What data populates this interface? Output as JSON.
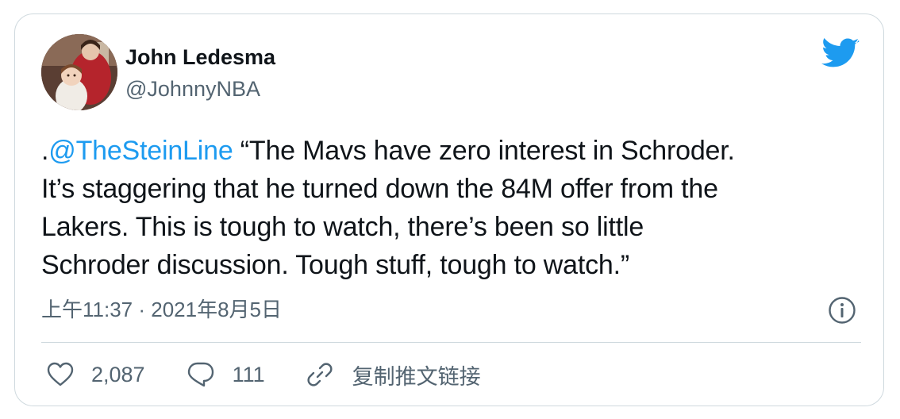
{
  "author": {
    "name": "John Ledesma",
    "handle": "@JohnnyNBA"
  },
  "tweet": {
    "prefix": ".",
    "mention": "@TheSteinLine",
    "line1_rest": " “The Mavs have zero interest in Schroder.",
    "line2": "It’s staggering that he turned down the 84M offer from the",
    "line3": "Lakers. This is tough to watch, there’s been so little",
    "line4": "Schroder discussion. Tough stuff, tough to watch.”"
  },
  "timestamp": "上午11:37 · 2021年8月5日",
  "actions": {
    "likes": "2,087",
    "replies": "111",
    "copy_link": "复制推文链接"
  },
  "colors": {
    "accent": "#1d9bf0",
    "text": "#0f1419",
    "secondary": "#536471",
    "border": "#cfd9de"
  },
  "icons": {
    "brand": "twitter-bird-icon",
    "info": "info-icon",
    "like": "heart-icon",
    "reply": "reply-bubble-icon",
    "link": "link-icon"
  }
}
